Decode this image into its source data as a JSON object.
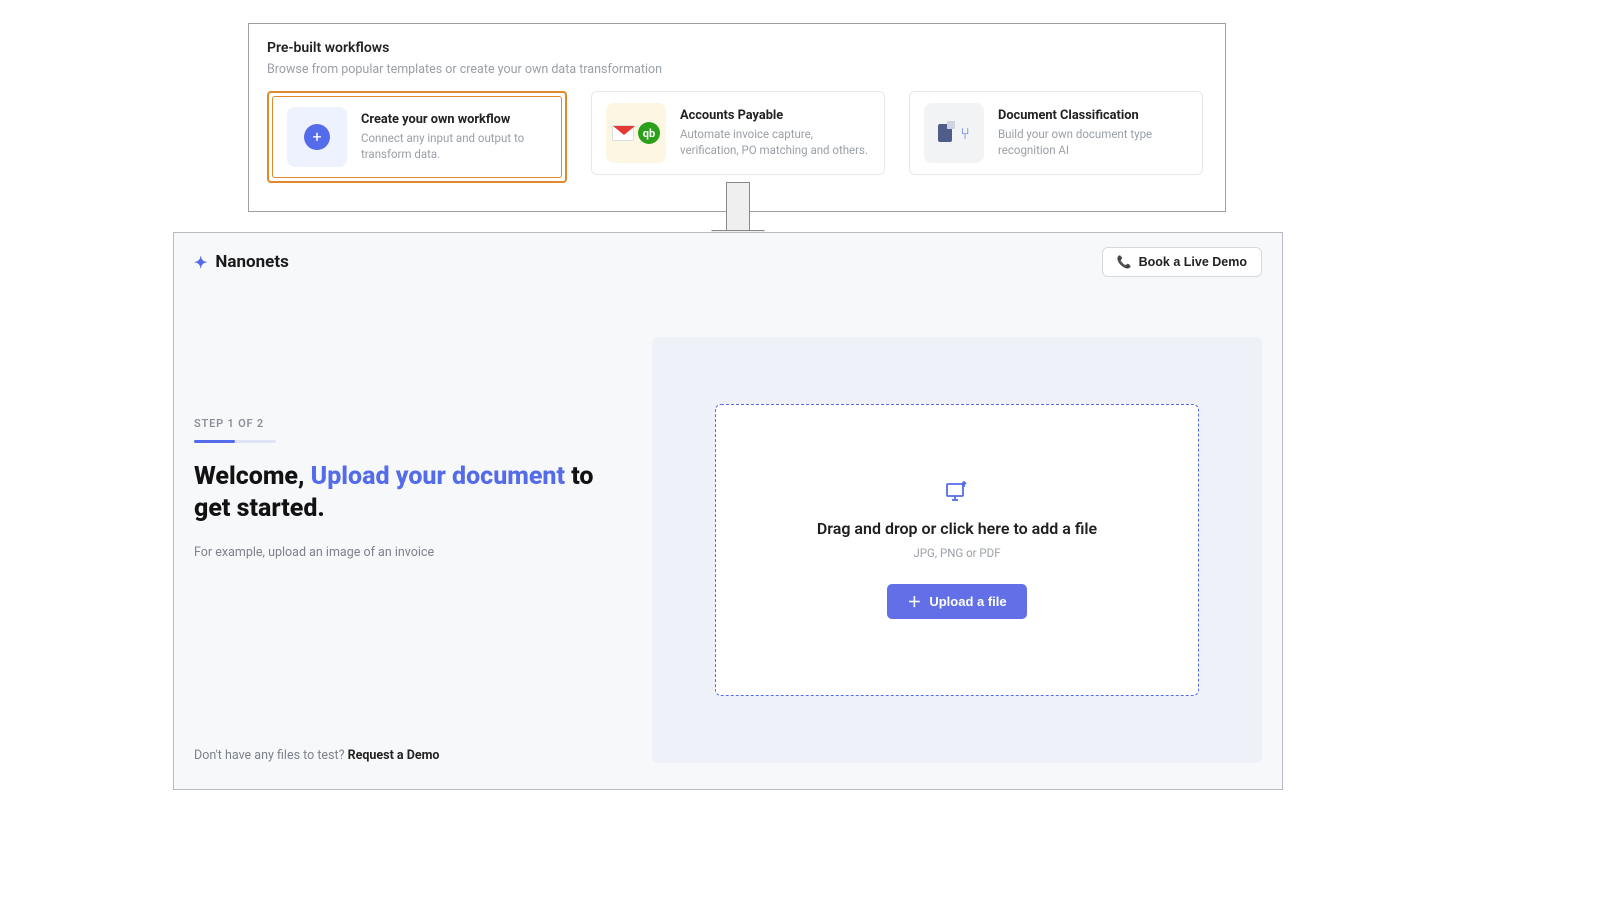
{
  "workflows": {
    "section_title": "Pre-built workflows",
    "section_subtitle": "Browse from popular templates or create your own data transformation",
    "cards": [
      {
        "title": "Create your own workflow",
        "description": "Connect any input and output to transform data.",
        "icon": "plus-circle-icon",
        "highlighted": true
      },
      {
        "title": "Accounts Payable",
        "description": "Automate invoice capture, verification, PO matching and others.",
        "icon": "gmail-quickbooks-icon",
        "highlighted": false
      },
      {
        "title": "Document Classification",
        "description": "Build your own document type recognition AI",
        "icon": "document-branch-icon",
        "highlighted": false
      }
    ]
  },
  "app": {
    "brand": "Nanonets",
    "demo_button": "Book a Live Demo",
    "step_label": "STEP 1 OF 2",
    "progress_fraction": 0.5,
    "welcome": {
      "prefix": "Welcome, ",
      "highlight": "Upload your document",
      "suffix": " to get started."
    },
    "example_text": "For example, upload an image of an invoice",
    "dropzone": {
      "title": "Drag and drop or click here to add a file",
      "subtitle": "JPG, PNG or PDF",
      "button": "Upload a file"
    },
    "footer": {
      "prefix": "Don't have any files to test? ",
      "link": "Request a Demo"
    }
  }
}
